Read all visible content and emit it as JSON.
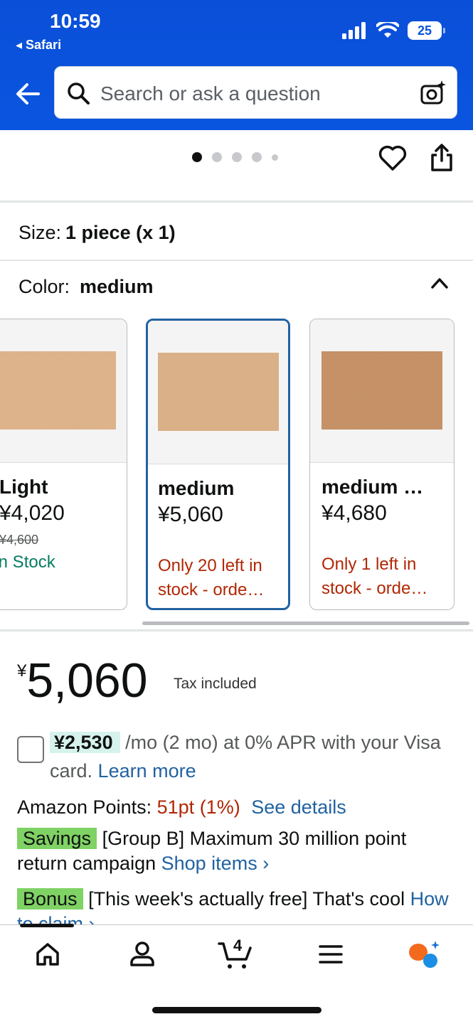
{
  "status_bar": {
    "time": "10:59",
    "back_app": "◂ Safari",
    "battery": "25"
  },
  "search": {
    "placeholder": "Search or ask a question"
  },
  "size": {
    "label": "Size:",
    "value": "1 piece (x 1)"
  },
  "color": {
    "label": "Color:",
    "value": "medium"
  },
  "variants": [
    {
      "name": "Light",
      "price": "¥4,020",
      "list_price": "¥4,600",
      "stock": "In Stock",
      "stock_status": "in",
      "swatch_color": "#e0b48a"
    },
    {
      "name": "medium",
      "price": "¥5,060",
      "list_price": "",
      "stock": "Only 20 left in stock - orde…",
      "stock_status": "low",
      "swatch_color": "#ddb187"
    },
    {
      "name": "medium …",
      "price": "¥4,680",
      "list_price": "",
      "stock": "Only 1 left in stock - orde…",
      "stock_status": "low",
      "swatch_color": "#c89063"
    }
  ],
  "price": {
    "currency": "¥",
    "amount": "5,060",
    "tax_note": "Tax included"
  },
  "installment": {
    "amount": "¥2,530",
    "text": "/mo (2 mo) at 0% APR with your Visa card.",
    "link": "Learn more"
  },
  "points": {
    "label": "Amazon Points:",
    "value": "51pt",
    "percent": "(1%)",
    "link": "See details"
  },
  "promos": [
    {
      "tag": "Savings",
      "text": "[Group B] Maximum 30 million point return campaign",
      "link": "Shop items ›"
    },
    {
      "tag": "Bonus",
      "text": "[This week's actually free] That's cool",
      "link": "How to claim ›"
    }
  ],
  "cart_count": "4",
  "colors": {
    "header": "#0a52dc",
    "link": "#2162a1",
    "price_red": "#b12704",
    "stock_green": "#067d62",
    "tag_green": "#7fd264",
    "selected_border": "#2162a1"
  }
}
